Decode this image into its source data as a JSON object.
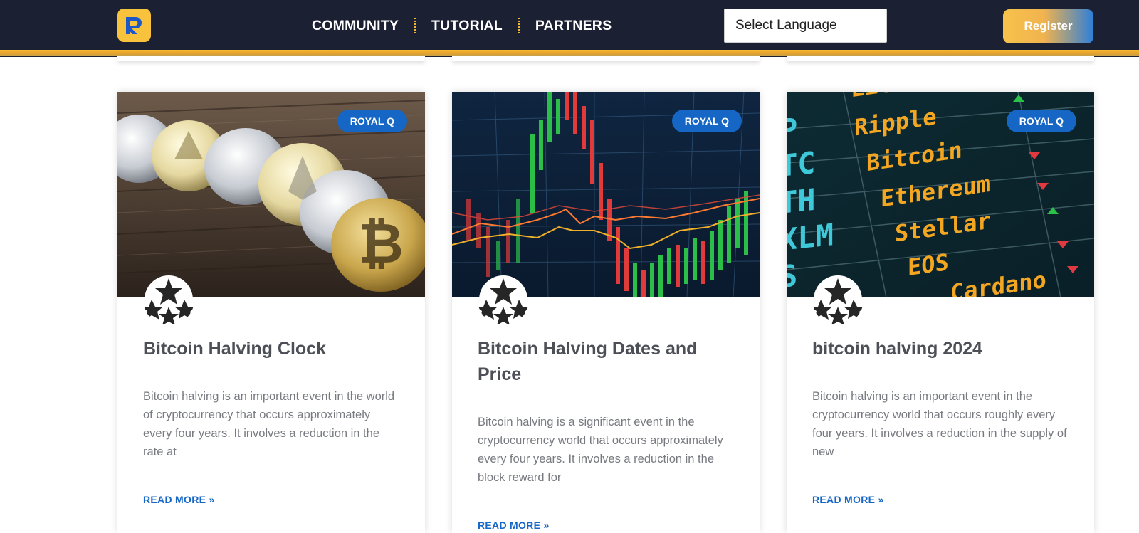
{
  "header": {
    "logo_alt": "R",
    "nav": [
      {
        "label": "COMMUNITY"
      },
      {
        "label": "TUTORIAL"
      },
      {
        "label": "PARTNERS"
      }
    ],
    "language_select": "Select Language",
    "register_label": "Register"
  },
  "colors": {
    "header_bg": "#1b2033",
    "accent_gold": "#f7b733",
    "badge_blue": "#1666c5",
    "link_blue": "#1666c5"
  },
  "cards": [
    {
      "badge": "ROYAL Q",
      "image": "crypto-coins-on-wood",
      "title": "Bitcoin Halving Clock",
      "excerpt": "Bitcoin halving is an important event in the world of cryptocurrency that occurs approximately every four years. It involves a reduction in the rate at",
      "read_more": "READ MORE »"
    },
    {
      "badge": "ROYAL Q",
      "image": "candlestick-trading-chart",
      "title": "Bitcoin Halving Dates and Price",
      "excerpt": "Bitcoin halving is a significant event in the cryptocurrency world that occurs approximately every four years. It involves a reduction in the block reward for",
      "read_more": "READ MORE »"
    },
    {
      "badge": "ROYAL Q",
      "image": "crypto-ticker-board",
      "title": "bitcoin halving 2024",
      "excerpt": "Bitcoin halving is an important event in the cryptocurrency world that occurs roughly every four years. It involves a reduction in the supply of new",
      "read_more": "READ MORE »",
      "ticker_left": [
        "P",
        "TC",
        "TH",
        "XLM",
        "S"
      ],
      "ticker_coins": [
        "Litecoin",
        "Ripple",
        "Bitcoin",
        "Ethereum",
        "Stellar",
        "EOS",
        "Cardano"
      ]
    }
  ]
}
